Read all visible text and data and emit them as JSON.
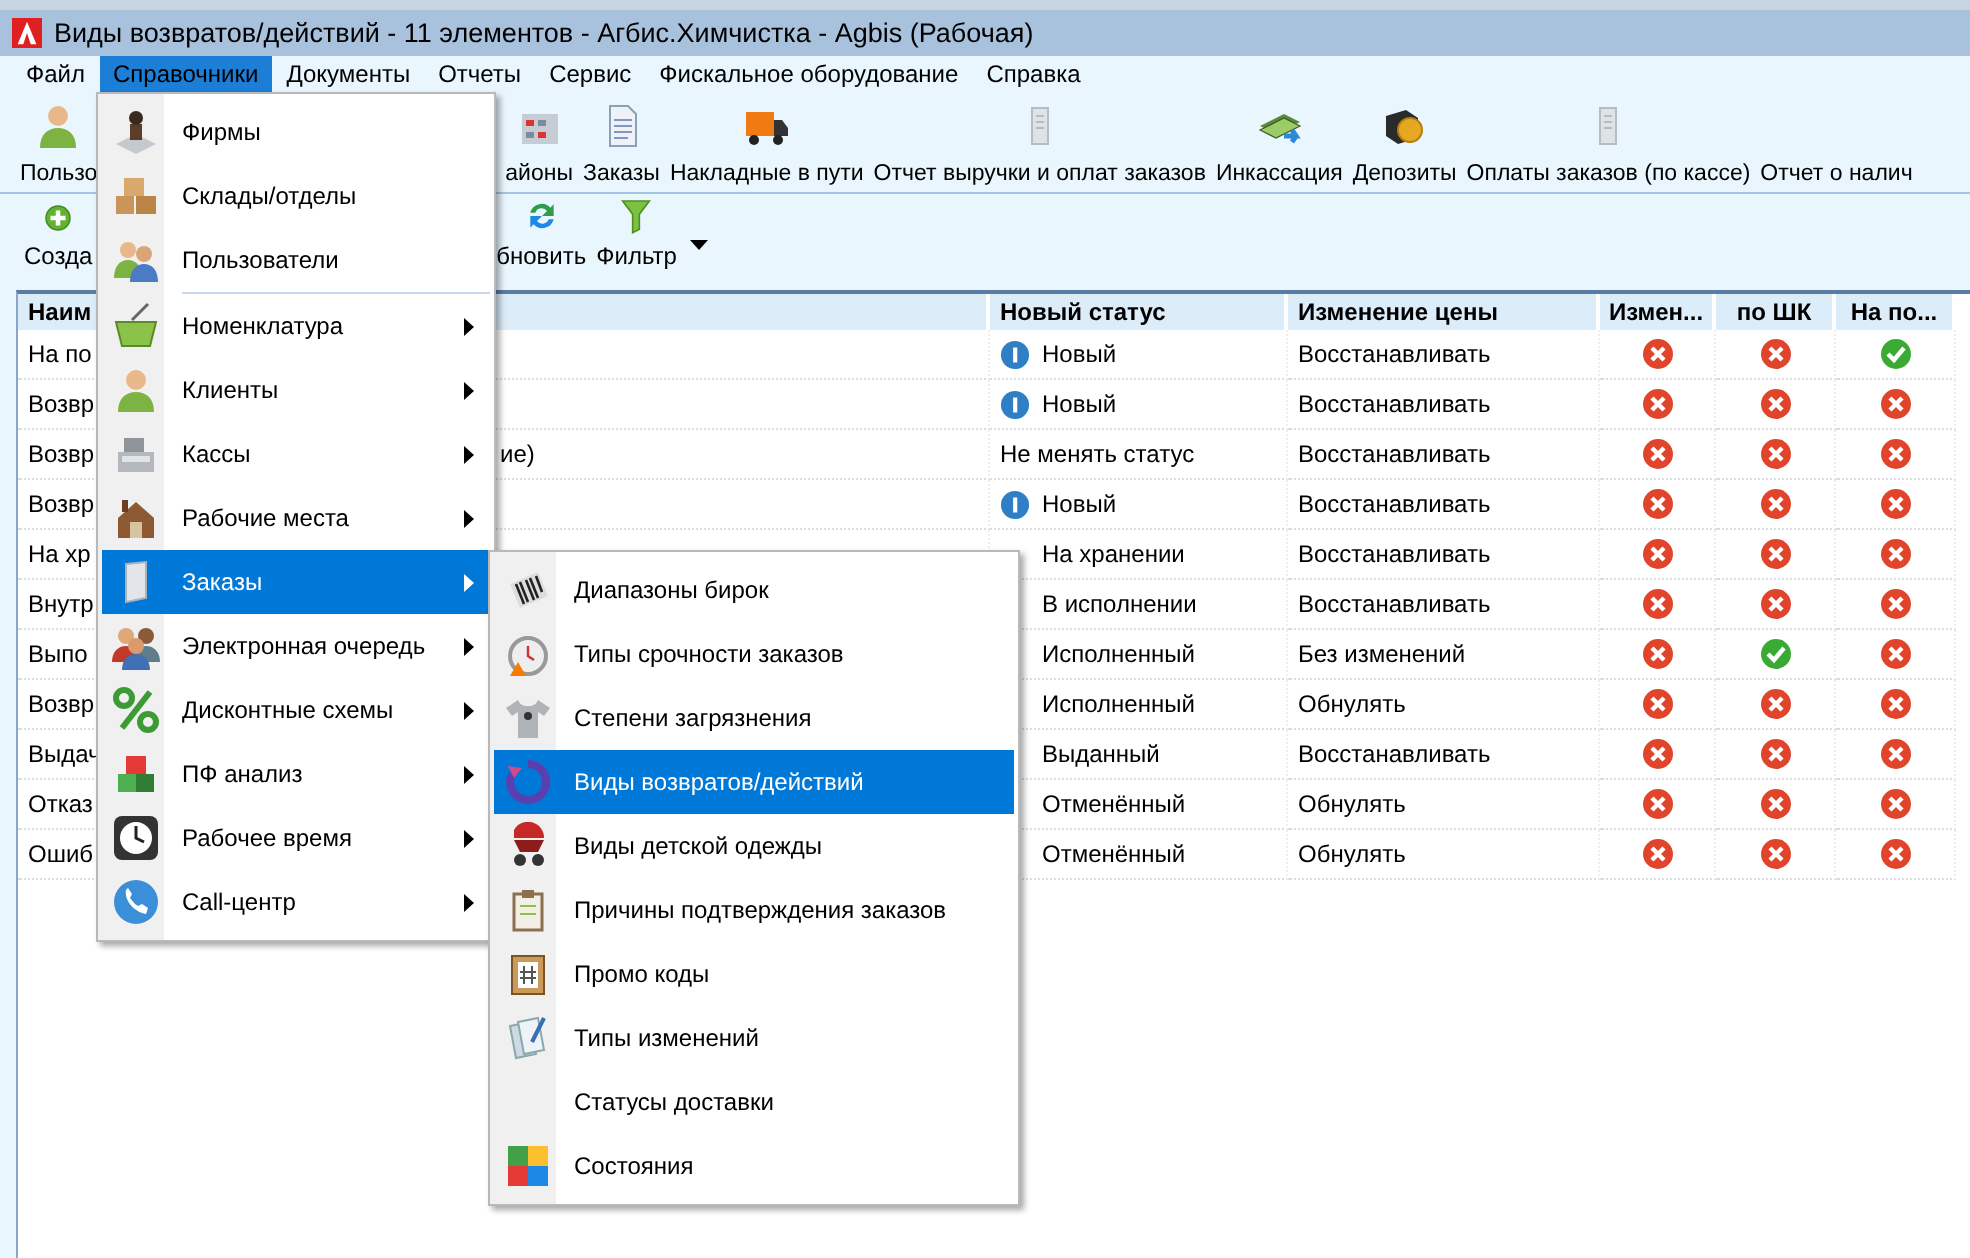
{
  "window": {
    "title": "Виды возвратов/действий - 11 элементов - Агбис.Химчистка - Agbis (Рабочая)"
  },
  "menu_bar": [
    {
      "label": "Файл",
      "selected": false
    },
    {
      "label": "Справочники",
      "selected": true
    },
    {
      "label": "Документы",
      "selected": false
    },
    {
      "label": "Отчеты",
      "selected": false
    },
    {
      "label": "Сервис",
      "selected": false
    },
    {
      "label": "Фискальное оборудование",
      "selected": false
    },
    {
      "label": "Справка",
      "selected": false
    }
  ],
  "toolbar": [
    {
      "label": "Пользо"
    },
    {
      "label": "айоны"
    },
    {
      "label": "Заказы"
    },
    {
      "label": "Накладные в пути"
    },
    {
      "label": "Отчет выручки и оплат заказов"
    },
    {
      "label": "Инкассация"
    },
    {
      "label": "Депозиты"
    },
    {
      "label": "Оплаты заказов (по кассе)"
    },
    {
      "label": "Отчет о налич"
    }
  ],
  "actions": [
    {
      "label": "Созда"
    },
    {
      "label": "бновить"
    },
    {
      "label": "Фильтр"
    }
  ],
  "table": {
    "columns": [
      {
        "label": "Наим"
      },
      {
        "label": "Новый статус"
      },
      {
        "label": "Изменение цены"
      },
      {
        "label": "Измен..."
      },
      {
        "label": "по ШК"
      },
      {
        "label": "На по..."
      }
    ],
    "rows": [
      {
        "kind": "info",
        "name": "На по",
        "status": "Новый",
        "price_change": "Восстанавливать",
        "flags": [
          false,
          false,
          true
        ]
      },
      {
        "kind": "info",
        "name": "Возвр",
        "status": "Новый",
        "price_change": "Восстанавливать",
        "flags": [
          false,
          false,
          false
        ]
      },
      {
        "kind": "plain",
        "name": "Возвр",
        "name_tail": "ие)",
        "status": "Не менять статус",
        "price_change": "Восстанавливать",
        "flags": [
          false,
          false,
          false
        ]
      },
      {
        "kind": "info",
        "name": "Возвр",
        "status": "Новый",
        "price_change": "Восстанавливать",
        "flags": [
          false,
          false,
          false
        ]
      },
      {
        "kind": "covered",
        "name": "На хр",
        "status": "На хранении",
        "price_change": "Восстанавливать",
        "flags": [
          false,
          false,
          false
        ]
      },
      {
        "kind": "covered",
        "name": "Внутр",
        "status": "В исполнении",
        "price_change": "Восстанавливать",
        "flags": [
          false,
          false,
          false
        ]
      },
      {
        "kind": "covered",
        "name": "Выпо",
        "status": "Исполненный",
        "price_change": "Без изменений",
        "flags": [
          false,
          true,
          false
        ]
      },
      {
        "kind": "covered",
        "name": "Возвр",
        "status": "Исполненный",
        "price_change": "Обнулять",
        "flags": [
          false,
          false,
          false
        ]
      },
      {
        "kind": "covered",
        "name": "Выдач",
        "status": "Выданный",
        "price_change": "Восстанавливать",
        "flags": [
          false,
          false,
          false
        ]
      },
      {
        "kind": "covered",
        "name": "Отказ",
        "status": "Отменённый",
        "price_change": "Обнулять",
        "flags": [
          false,
          false,
          false
        ]
      },
      {
        "kind": "covered",
        "name": "Ошиб",
        "status": "Отменённый",
        "price_change": "Обнулять",
        "flags": [
          false,
          false,
          false
        ]
      }
    ]
  },
  "dropdown_menu": {
    "items": [
      {
        "kind": "item",
        "label": "Фирмы",
        "has_submenu": false,
        "selected": false
      },
      {
        "kind": "item",
        "label": "Склады/отделы",
        "has_submenu": false,
        "selected": false
      },
      {
        "kind": "item",
        "label": "Пользователи",
        "has_submenu": false,
        "selected": false
      },
      {
        "kind": "separator"
      },
      {
        "kind": "item",
        "label": "Номенклатура",
        "has_submenu": true,
        "selected": false
      },
      {
        "kind": "item",
        "label": "Клиенты",
        "has_submenu": true,
        "selected": false
      },
      {
        "kind": "item",
        "label": "Кассы",
        "has_submenu": true,
        "selected": false
      },
      {
        "kind": "item",
        "label": "Рабочие места",
        "has_submenu": true,
        "selected": false
      },
      {
        "kind": "item",
        "label": "Заказы",
        "has_submenu": true,
        "selected": true
      },
      {
        "kind": "item",
        "label": "Электронная очередь",
        "has_submenu": true,
        "selected": false
      },
      {
        "kind": "item",
        "label": "Дисконтные схемы",
        "has_submenu": true,
        "selected": false
      },
      {
        "kind": "item",
        "label": "ПФ анализ",
        "has_submenu": true,
        "selected": false
      },
      {
        "kind": "item",
        "label": "Рабочее время",
        "has_submenu": true,
        "selected": false
      },
      {
        "kind": "item",
        "label": "Call-центр",
        "has_submenu": true,
        "selected": false
      }
    ]
  },
  "submenu": {
    "items": [
      {
        "label": "Диапазоны бирок",
        "selected": false
      },
      {
        "label": "Типы срочности заказов",
        "selected": false
      },
      {
        "label": "Степени загрязнения",
        "selected": false
      },
      {
        "label": "Виды возвратов/действий",
        "selected": true
      },
      {
        "label": "Виды детской одежды",
        "selected": false
      },
      {
        "label": "Причины подтверждения заказов",
        "selected": false
      },
      {
        "label": "Промо коды",
        "selected": false
      },
      {
        "label": "Типы изменений",
        "selected": false
      },
      {
        "label": "Статусы доставки",
        "selected": false
      },
      {
        "label": "Состояния",
        "selected": false
      }
    ]
  }
}
